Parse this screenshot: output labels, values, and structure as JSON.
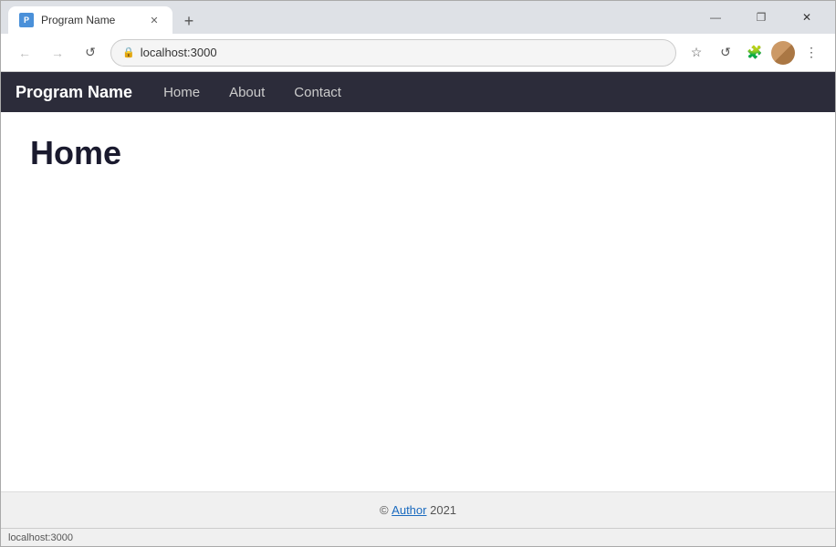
{
  "browser": {
    "tab_label": "Program Name",
    "tab_favicon_text": "P",
    "url": "localhost:3000",
    "new_tab_icon": "+",
    "close_icon": "✕",
    "minimize_icon": "—",
    "restore_icon": "❐"
  },
  "navbar": {
    "back_icon": "←",
    "forward_icon": "→",
    "reload_icon": "↺",
    "lock_icon": "🔒",
    "star_icon": "☆",
    "extensions_icon": "🧩",
    "menu_icon": "⋮"
  },
  "app": {
    "brand": "Program Name",
    "nav_links": [
      {
        "label": "Home"
      },
      {
        "label": "About"
      },
      {
        "label": "Contact"
      }
    ]
  },
  "page": {
    "heading": "Home"
  },
  "footer": {
    "copyright": "©",
    "link_text": "Author",
    "year": "2021"
  },
  "status_bar": {
    "text": "localhost:3000"
  }
}
